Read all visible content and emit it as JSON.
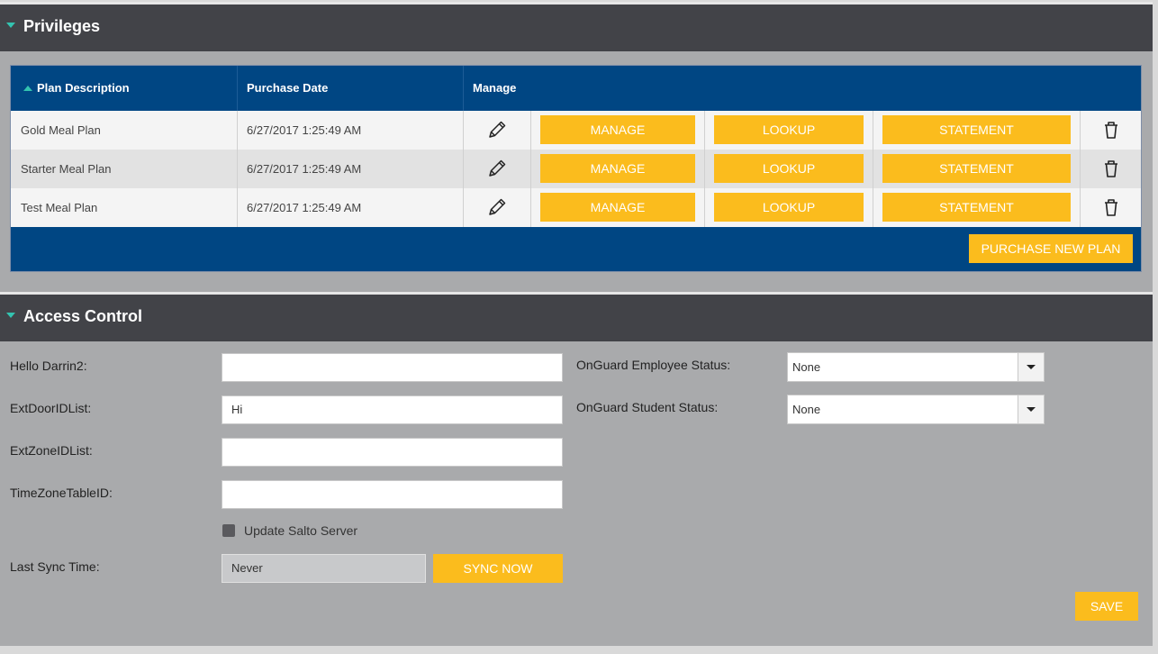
{
  "privileges": {
    "title": "Privileges",
    "columns": [
      "Plan Description",
      "Purchase Date",
      "Manage"
    ],
    "rows": [
      {
        "plan": "Gold Meal Plan",
        "date": "6/27/2017 1:25:49 AM"
      },
      {
        "plan": "Starter Meal Plan",
        "date": "6/27/2017 1:25:49 AM"
      },
      {
        "plan": "Test Meal Plan",
        "date": "6/27/2017 1:25:49 AM"
      }
    ],
    "row_actions": {
      "manage": "MANAGE",
      "lookup": "LOOKUP",
      "statement": "STATEMENT",
      "edit_icon": "pencil-icon",
      "delete_icon": "trash-icon"
    },
    "purchase_label": "PURCHASE NEW PLAN"
  },
  "access": {
    "title": "Access Control",
    "hello_label": "Hello Darrin2:",
    "hello_value": "",
    "door_label": "ExtDoorIDList:",
    "door_value": "Hi",
    "zone_label": "ExtZoneIDList:",
    "zone_value": "",
    "tz_label": "TimeZoneTableID:",
    "tz_value": "",
    "salto_label": "Update Salto Server",
    "salto_checked": false,
    "sync_label": "Last Sync Time:",
    "sync_value": "Never",
    "sync_button": "SYNC NOW",
    "employee_label": "OnGuard Employee Status:",
    "employee_value": "None",
    "student_label": "OnGuard Student Status:",
    "student_value": "None",
    "save_button": "SAVE"
  },
  "colors": {
    "header": "#424348",
    "grid_header": "#004683",
    "accent": "#fbbc1d",
    "caret": "#33c3b0"
  }
}
